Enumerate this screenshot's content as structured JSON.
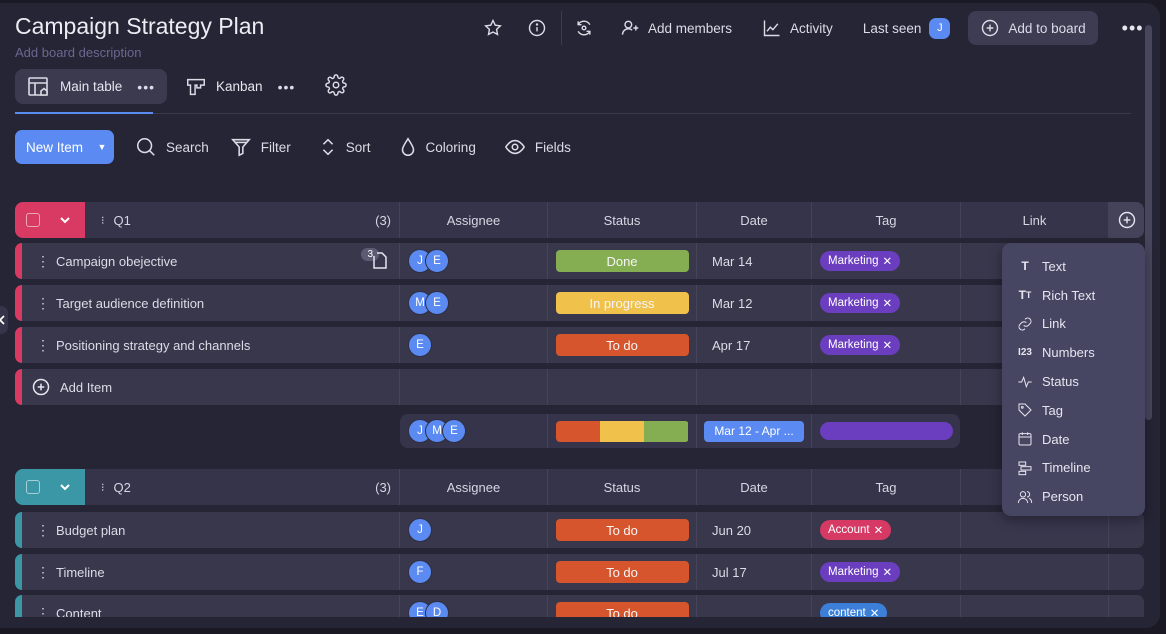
{
  "board": {
    "title": "Campaign Strategy Plan",
    "description_placeholder": "Add board description"
  },
  "topbar": {
    "add_members": "Add members",
    "activity": "Activity",
    "last_seen": "Last seen",
    "last_seen_avatar": "J",
    "add_to_board": "Add to board",
    "more": "•••"
  },
  "views": [
    {
      "label": "Main table",
      "more": "•••",
      "active": true
    },
    {
      "label": "Kanban",
      "more": "•••",
      "active": false
    }
  ],
  "toolbar": {
    "new_item": "New Item",
    "search": "Search",
    "filter": "Filter",
    "sort": "Sort",
    "coloring": "Coloring",
    "fields": "Fields"
  },
  "columns": {
    "assignee": "Assignee",
    "status": "Status",
    "date": "Date",
    "tag": "Tag",
    "link": "Link"
  },
  "colors": {
    "q1": "#d83a63",
    "q2": "#3b97a6",
    "done": "#85ae53",
    "in_progress": "#f0c14b",
    "todo": "#d6552d",
    "marketing": "#6b3ec0",
    "account": "#d63a64",
    "content": "#3c7fd8",
    "accent": "#5b8bf2"
  },
  "groups": [
    {
      "name": "Q1",
      "count": "(3)",
      "items": [
        {
          "name": "Campaign obejective",
          "files": "3",
          "assignees": [
            "J",
            "E"
          ],
          "status": "Done",
          "date": "Mar 14",
          "tag": "Marketing"
        },
        {
          "name": "Target audience definition",
          "assignees": [
            "M",
            "E"
          ],
          "status": "In progress",
          "date": "Mar 12",
          "tag": "Marketing"
        },
        {
          "name": "Positioning strategy and channels",
          "assignees": [
            "E"
          ],
          "status": "To do",
          "date": "Apr 17",
          "tag": "Marketing"
        }
      ],
      "add_item": "Add Item",
      "summary": {
        "assignees": [
          "J",
          "M",
          "E"
        ],
        "status_distribution": {
          "To do": 1,
          "In progress": 1,
          "Done": 1
        },
        "date_range": "Mar 12 - Apr ..."
      }
    },
    {
      "name": "Q2",
      "count": "(3)",
      "items": [
        {
          "name": "Budget plan",
          "assignees": [
            "J"
          ],
          "status": "To do",
          "date": "Jun 20",
          "tag": "Account"
        },
        {
          "name": "Timeline",
          "assignees": [
            "F"
          ],
          "status": "To do",
          "date": "Jul 17",
          "tag": "Marketing"
        },
        {
          "name": "Content",
          "assignees": [
            "E",
            "D"
          ],
          "status": "To do",
          "date": "",
          "tag": "content"
        }
      ]
    }
  ],
  "tag_remove": "✕",
  "column_menu": [
    {
      "icon": "text-icon",
      "label": "Text"
    },
    {
      "icon": "rich-text-icon",
      "label": "Rich Text"
    },
    {
      "icon": "link-icon",
      "label": "Link"
    },
    {
      "icon": "numbers-icon",
      "label": "Numbers"
    },
    {
      "icon": "status-icon",
      "label": "Status"
    },
    {
      "icon": "tag-icon",
      "label": "Tag"
    },
    {
      "icon": "date-icon",
      "label": "Date"
    },
    {
      "icon": "timeline-icon",
      "label": "Timeline"
    },
    {
      "icon": "person-icon",
      "label": "Person"
    }
  ]
}
